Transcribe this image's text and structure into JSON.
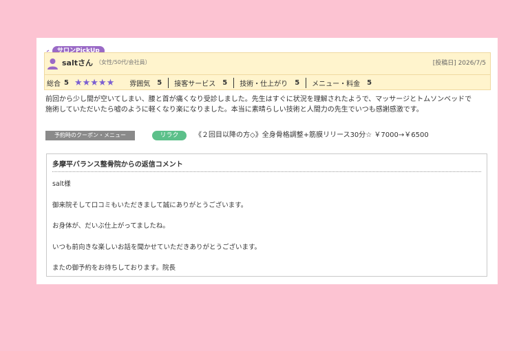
{
  "colors": {
    "background": "#fcc3d2",
    "badge": "#9a6ac6",
    "header_bg": "#fff4cd",
    "stars": "#7b5fd1",
    "coupon_tag": "#5cc08a"
  },
  "badge": "サロンPickUp",
  "reviewer": {
    "name": "saltさん",
    "meta": "（女性/50代/会社員）",
    "avatar_icon": "person-icon"
  },
  "post_date": "[投稿日] 2026/7/5",
  "ratings": {
    "overall_label": "総合",
    "overall_value": "5",
    "stars": "★★★★★",
    "star_count": 5,
    "items": [
      {
        "label": "雰囲気",
        "value": "5"
      },
      {
        "label": "接客サービス",
        "value": "5"
      },
      {
        "label": "技術・仕上がり",
        "value": "5"
      },
      {
        "label": "メニュー・料金",
        "value": "5"
      }
    ]
  },
  "review": {
    "line1": "前回から少し間が空いてしまい、腰と首が痛くなり受診しました。先生はすぐに状況を理解されたようで、マッサージとトムソンベッドで",
    "line2": "施術していただいたら嘘のように軽くなり楽になりました。本当に素晴らしい技術と人間力の先生でいつも感謝感激です。"
  },
  "coupon": {
    "label": "予約時のクーポン・メニュー",
    "tag": "リラク",
    "text": "《２回目以降の方◇》全身骨格調整+筋膜リリース30分☆ ￥7000→￥6500"
  },
  "reply": {
    "title": "多摩平バランス整骨院からの返信コメント",
    "lines": [
      "salt様",
      "御来院そして口コミもいただきまして誠にありがとうございます。",
      "お身体が、だいぶ仕上がってましたね。",
      "いつも前向きな楽しいお話を聞かせていただきありがとうございます。",
      "またの御予約をお待ちしております。院長"
    ]
  }
}
